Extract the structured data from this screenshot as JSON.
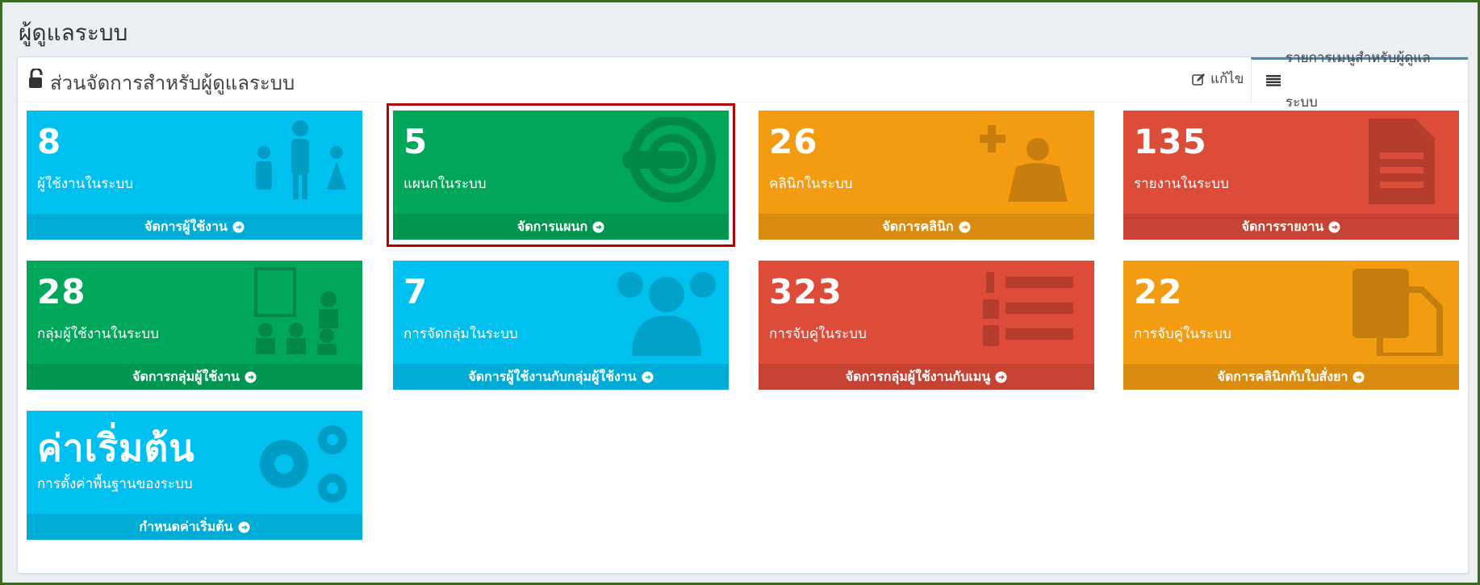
{
  "page": {
    "title": "ผู้ดูแลระบบ"
  },
  "panel": {
    "title": "ส่วนจัดการสำหรับผู้ดูแลระบบ",
    "tabs": [
      {
        "label": "แก้ไข",
        "icon": "edit-icon"
      },
      {
        "label": "รายการเมนูสำหรับผู้ดูแลระบบ",
        "icon": "list-icon"
      }
    ]
  },
  "colors": {
    "aqua": "#00c0ef",
    "green": "#00a65a",
    "yellow": "#f39c12",
    "red": "#dd4b39",
    "highlight": "#b30000"
  },
  "boxes": [
    {
      "value": "8",
      "label": "ผู้ใช้งานในระบบ",
      "link": "จัดการผู้ใช้งาน",
      "icon": "users-group-icon"
    },
    {
      "value": "5",
      "label": "แผนกในระบบ",
      "link": "จัดการแผนก",
      "icon": "mri-scanner-icon"
    },
    {
      "value": "26",
      "label": "คลินิกในระบบ",
      "link": "จัดการคลินิก",
      "icon": "reader-plus-icon"
    },
    {
      "value": "135",
      "label": "รายงานในระบบ",
      "link": "จัดการรายงาน",
      "icon": "document-icon"
    },
    {
      "value": "28",
      "label": "กลุ่มผู้ใช้งานในระบบ",
      "link": "จัดการกลุ่มผู้ใช้งาน",
      "icon": "presentation-icon"
    },
    {
      "value": "7",
      "label": "การจัดกลุ่มในระบบ",
      "link": "จัดการผู้ใช้งานกับกลุ่มผู้ใช้งาน",
      "icon": "people-icon"
    },
    {
      "value": "323",
      "label": "การจับคู่ในระบบ",
      "link": "จัดการกลุ่มผู้ใช้งานกับเมนู",
      "icon": "numbered-list-icon"
    },
    {
      "value": "22",
      "label": "การจับคู่ในระบบ",
      "link": "จัดการคลินิกกับใบสั่งยา",
      "icon": "copy-icon"
    },
    {
      "value": "ค่าเริ่มต้น",
      "label": "การตั้งค่าพื้นฐานของระบบ",
      "link": "กำหนดค่าเริ่มต้น",
      "icon": "gears-icon"
    }
  ]
}
